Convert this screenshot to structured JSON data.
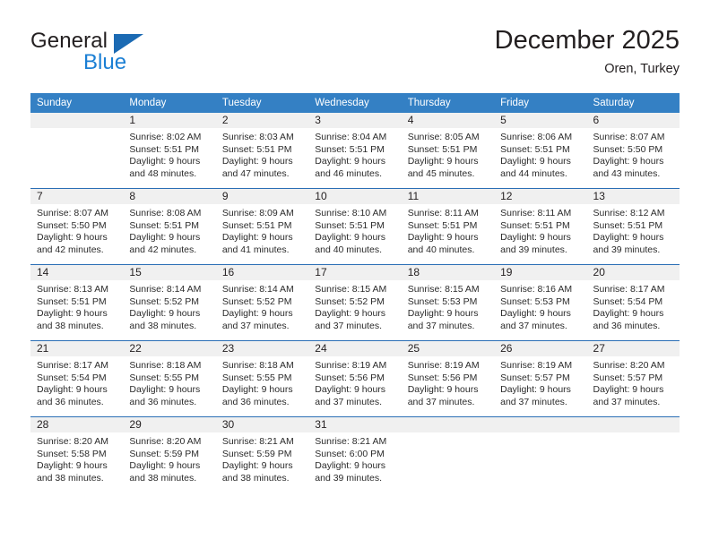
{
  "brand": {
    "word_one": "General",
    "word_two": "Blue",
    "triangle_icon": "blue-triangle-icon",
    "accent_blue": "#1b7fd4",
    "triangle_blue": "#1b6ab3"
  },
  "header": {
    "title": "December 2025",
    "subtitle": "Oren, Turkey"
  },
  "theme": {
    "header_row_bg": "#3480c4",
    "header_row_text": "#ffffff",
    "daynum_bg": "#f0f0f0",
    "row_divider": "#2a6eb5",
    "body_text": "#2b2b2b"
  },
  "weekdays": [
    "Sunday",
    "Monday",
    "Tuesday",
    "Wednesday",
    "Thursday",
    "Friday",
    "Saturday"
  ],
  "weeks": [
    [
      {
        "day": "",
        "sunrise": "",
        "sunset": "",
        "daylight_line1": "",
        "daylight_line2": ""
      },
      {
        "day": "1",
        "sunrise": "Sunrise: 8:02 AM",
        "sunset": "Sunset: 5:51 PM",
        "daylight_line1": "Daylight: 9 hours",
        "daylight_line2": "and 48 minutes."
      },
      {
        "day": "2",
        "sunrise": "Sunrise: 8:03 AM",
        "sunset": "Sunset: 5:51 PM",
        "daylight_line1": "Daylight: 9 hours",
        "daylight_line2": "and 47 minutes."
      },
      {
        "day": "3",
        "sunrise": "Sunrise: 8:04 AM",
        "sunset": "Sunset: 5:51 PM",
        "daylight_line1": "Daylight: 9 hours",
        "daylight_line2": "and 46 minutes."
      },
      {
        "day": "4",
        "sunrise": "Sunrise: 8:05 AM",
        "sunset": "Sunset: 5:51 PM",
        "daylight_line1": "Daylight: 9 hours",
        "daylight_line2": "and 45 minutes."
      },
      {
        "day": "5",
        "sunrise": "Sunrise: 8:06 AM",
        "sunset": "Sunset: 5:51 PM",
        "daylight_line1": "Daylight: 9 hours",
        "daylight_line2": "and 44 minutes."
      },
      {
        "day": "6",
        "sunrise": "Sunrise: 8:07 AM",
        "sunset": "Sunset: 5:50 PM",
        "daylight_line1": "Daylight: 9 hours",
        "daylight_line2": "and 43 minutes."
      }
    ],
    [
      {
        "day": "7",
        "sunrise": "Sunrise: 8:07 AM",
        "sunset": "Sunset: 5:50 PM",
        "daylight_line1": "Daylight: 9 hours",
        "daylight_line2": "and 42 minutes."
      },
      {
        "day": "8",
        "sunrise": "Sunrise: 8:08 AM",
        "sunset": "Sunset: 5:51 PM",
        "daylight_line1": "Daylight: 9 hours",
        "daylight_line2": "and 42 minutes."
      },
      {
        "day": "9",
        "sunrise": "Sunrise: 8:09 AM",
        "sunset": "Sunset: 5:51 PM",
        "daylight_line1": "Daylight: 9 hours",
        "daylight_line2": "and 41 minutes."
      },
      {
        "day": "10",
        "sunrise": "Sunrise: 8:10 AM",
        "sunset": "Sunset: 5:51 PM",
        "daylight_line1": "Daylight: 9 hours",
        "daylight_line2": "and 40 minutes."
      },
      {
        "day": "11",
        "sunrise": "Sunrise: 8:11 AM",
        "sunset": "Sunset: 5:51 PM",
        "daylight_line1": "Daylight: 9 hours",
        "daylight_line2": "and 40 minutes."
      },
      {
        "day": "12",
        "sunrise": "Sunrise: 8:11 AM",
        "sunset": "Sunset: 5:51 PM",
        "daylight_line1": "Daylight: 9 hours",
        "daylight_line2": "and 39 minutes."
      },
      {
        "day": "13",
        "sunrise": "Sunrise: 8:12 AM",
        "sunset": "Sunset: 5:51 PM",
        "daylight_line1": "Daylight: 9 hours",
        "daylight_line2": "and 39 minutes."
      }
    ],
    [
      {
        "day": "14",
        "sunrise": "Sunrise: 8:13 AM",
        "sunset": "Sunset: 5:51 PM",
        "daylight_line1": "Daylight: 9 hours",
        "daylight_line2": "and 38 minutes."
      },
      {
        "day": "15",
        "sunrise": "Sunrise: 8:14 AM",
        "sunset": "Sunset: 5:52 PM",
        "daylight_line1": "Daylight: 9 hours",
        "daylight_line2": "and 38 minutes."
      },
      {
        "day": "16",
        "sunrise": "Sunrise: 8:14 AM",
        "sunset": "Sunset: 5:52 PM",
        "daylight_line1": "Daylight: 9 hours",
        "daylight_line2": "and 37 minutes."
      },
      {
        "day": "17",
        "sunrise": "Sunrise: 8:15 AM",
        "sunset": "Sunset: 5:52 PM",
        "daylight_line1": "Daylight: 9 hours",
        "daylight_line2": "and 37 minutes."
      },
      {
        "day": "18",
        "sunrise": "Sunrise: 8:15 AM",
        "sunset": "Sunset: 5:53 PM",
        "daylight_line1": "Daylight: 9 hours",
        "daylight_line2": "and 37 minutes."
      },
      {
        "day": "19",
        "sunrise": "Sunrise: 8:16 AM",
        "sunset": "Sunset: 5:53 PM",
        "daylight_line1": "Daylight: 9 hours",
        "daylight_line2": "and 37 minutes."
      },
      {
        "day": "20",
        "sunrise": "Sunrise: 8:17 AM",
        "sunset": "Sunset: 5:54 PM",
        "daylight_line1": "Daylight: 9 hours",
        "daylight_line2": "and 36 minutes."
      }
    ],
    [
      {
        "day": "21",
        "sunrise": "Sunrise: 8:17 AM",
        "sunset": "Sunset: 5:54 PM",
        "daylight_line1": "Daylight: 9 hours",
        "daylight_line2": "and 36 minutes."
      },
      {
        "day": "22",
        "sunrise": "Sunrise: 8:18 AM",
        "sunset": "Sunset: 5:55 PM",
        "daylight_line1": "Daylight: 9 hours",
        "daylight_line2": "and 36 minutes."
      },
      {
        "day": "23",
        "sunrise": "Sunrise: 8:18 AM",
        "sunset": "Sunset: 5:55 PM",
        "daylight_line1": "Daylight: 9 hours",
        "daylight_line2": "and 36 minutes."
      },
      {
        "day": "24",
        "sunrise": "Sunrise: 8:19 AM",
        "sunset": "Sunset: 5:56 PM",
        "daylight_line1": "Daylight: 9 hours",
        "daylight_line2": "and 37 minutes."
      },
      {
        "day": "25",
        "sunrise": "Sunrise: 8:19 AM",
        "sunset": "Sunset: 5:56 PM",
        "daylight_line1": "Daylight: 9 hours",
        "daylight_line2": "and 37 minutes."
      },
      {
        "day": "26",
        "sunrise": "Sunrise: 8:19 AM",
        "sunset": "Sunset: 5:57 PM",
        "daylight_line1": "Daylight: 9 hours",
        "daylight_line2": "and 37 minutes."
      },
      {
        "day": "27",
        "sunrise": "Sunrise: 8:20 AM",
        "sunset": "Sunset: 5:57 PM",
        "daylight_line1": "Daylight: 9 hours",
        "daylight_line2": "and 37 minutes."
      }
    ],
    [
      {
        "day": "28",
        "sunrise": "Sunrise: 8:20 AM",
        "sunset": "Sunset: 5:58 PM",
        "daylight_line1": "Daylight: 9 hours",
        "daylight_line2": "and 38 minutes."
      },
      {
        "day": "29",
        "sunrise": "Sunrise: 8:20 AM",
        "sunset": "Sunset: 5:59 PM",
        "daylight_line1": "Daylight: 9 hours",
        "daylight_line2": "and 38 minutes."
      },
      {
        "day": "30",
        "sunrise": "Sunrise: 8:21 AM",
        "sunset": "Sunset: 5:59 PM",
        "daylight_line1": "Daylight: 9 hours",
        "daylight_line2": "and 38 minutes."
      },
      {
        "day": "31",
        "sunrise": "Sunrise: 8:21 AM",
        "sunset": "Sunset: 6:00 PM",
        "daylight_line1": "Daylight: 9 hours",
        "daylight_line2": "and 39 minutes."
      },
      {
        "day": "",
        "sunrise": "",
        "sunset": "",
        "daylight_line1": "",
        "daylight_line2": ""
      },
      {
        "day": "",
        "sunrise": "",
        "sunset": "",
        "daylight_line1": "",
        "daylight_line2": ""
      },
      {
        "day": "",
        "sunrise": "",
        "sunset": "",
        "daylight_line1": "",
        "daylight_line2": ""
      }
    ]
  ]
}
